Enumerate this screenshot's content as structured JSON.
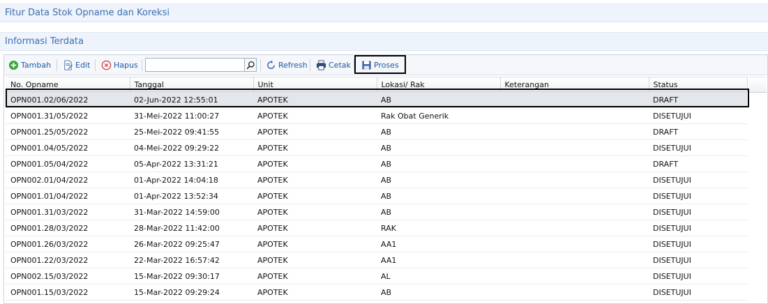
{
  "header": {
    "title": "Fitur Data Stok Opname dan Koreksi"
  },
  "section": {
    "title": "Informasi Terdata"
  },
  "toolbar": {
    "tambah_label": "Tambah",
    "edit_label": "Edit",
    "hapus_label": "Hapus",
    "search_value": "",
    "refresh_label": "Refresh",
    "cetak_label": "Cetak",
    "proses_label": "Proses"
  },
  "table": {
    "columns": [
      "No. Opname",
      "Tanggal",
      "Unit",
      "Lokasi/ Rak",
      "Keterangan",
      "Status"
    ],
    "rows": [
      [
        "OPN001.02/06/2022",
        "02-Jun-2022 12:55:01",
        "APOTEK",
        "AB",
        "",
        "DRAFT"
      ],
      [
        "OPN001.31/05/2022",
        "31-Mei-2022 11:00:27",
        "APOTEK",
        "Rak Obat Generik",
        "",
        "DISETUJUI"
      ],
      [
        "OPN001.25/05/2022",
        "25-Mei-2022 09:41:55",
        "APOTEK",
        "AB",
        "",
        "DRAFT"
      ],
      [
        "OPN001.04/05/2022",
        "04-Mei-2022 09:29:22",
        "APOTEK",
        "AB",
        "",
        "DISETUJUI"
      ],
      [
        "OPN001.05/04/2022",
        "05-Apr-2022 13:31:21",
        "APOTEK",
        "AB",
        "",
        "DRAFT"
      ],
      [
        "OPN002.01/04/2022",
        "01-Apr-2022 14:04:18",
        "APOTEK",
        "AB",
        "",
        "DISETUJUI"
      ],
      [
        "OPN001.01/04/2022",
        "01-Apr-2022 13:52:34",
        "APOTEK",
        "AB",
        "",
        "DISETUJUI"
      ],
      [
        "OPN001.31/03/2022",
        "31-Mar-2022 14:59:00",
        "APOTEK",
        "AB",
        "",
        "DISETUJUI"
      ],
      [
        "OPN001.28/03/2022",
        "28-Mar-2022 11:42:00",
        "APOTEK",
        "RAK",
        "",
        "DISETUJUI"
      ],
      [
        "OPN001.26/03/2022",
        "26-Mar-2022 09:25:47",
        "APOTEK",
        "AA1",
        "",
        "DISETUJUI"
      ],
      [
        "OPN001.22/03/2022",
        "22-Mar-2022 16:57:42",
        "APOTEK",
        "AA1",
        "",
        "DISETUJUI"
      ],
      [
        "OPN002.15/03/2022",
        "15-Mar-2022 09:30:17",
        "APOTEK",
        "AL",
        "",
        "DISETUJUI"
      ],
      [
        "OPN001.15/03/2022",
        "15-Mar-2022 09:29:24",
        "APOTEK",
        "AB",
        "",
        "DISETUJUI"
      ]
    ],
    "selected_row": 0
  }
}
